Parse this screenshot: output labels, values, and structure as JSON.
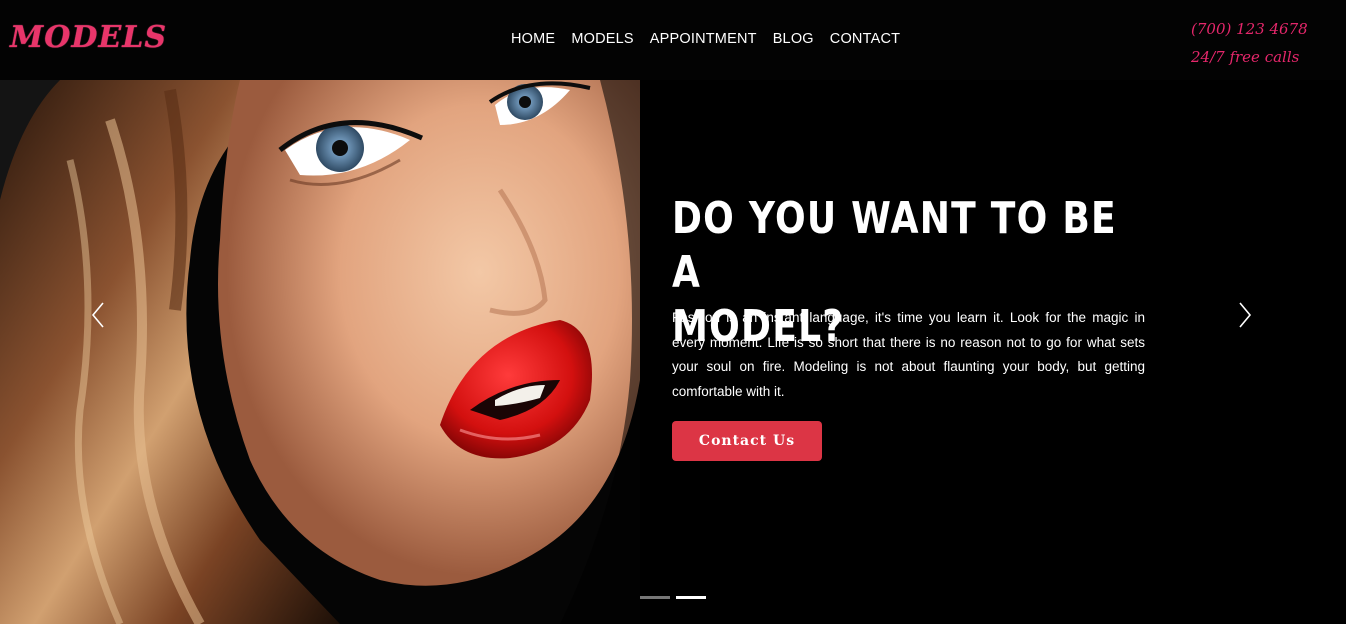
{
  "header": {
    "logo": "MODELS",
    "nav": [
      "HOME",
      "MODELS",
      "APPOINTMENT",
      "BLOG",
      "CONTACT"
    ],
    "phone": "(700) 123 4678",
    "phone_note": "24/7 free calls"
  },
  "hero": {
    "headline_line1": "DO YOU WANT TO BE A",
    "headline_line2": "MODEL?",
    "description": "Fashion is an instant language, it's time you learn it. Look for the magic in every moment. Life is so short that there is no reason not to go for what sets your soul on fire. Modeling is not about flaunting your body, but getting comfortable with it.",
    "cta_label": "Contact Us",
    "prev_icon": "chevron-left-icon",
    "next_icon": "chevron-right-icon",
    "slides_total": 2,
    "active_slide": 2
  },
  "colors": {
    "brand_pink": "#e8356a",
    "cta_red": "#dc3545",
    "background": "#000000"
  }
}
